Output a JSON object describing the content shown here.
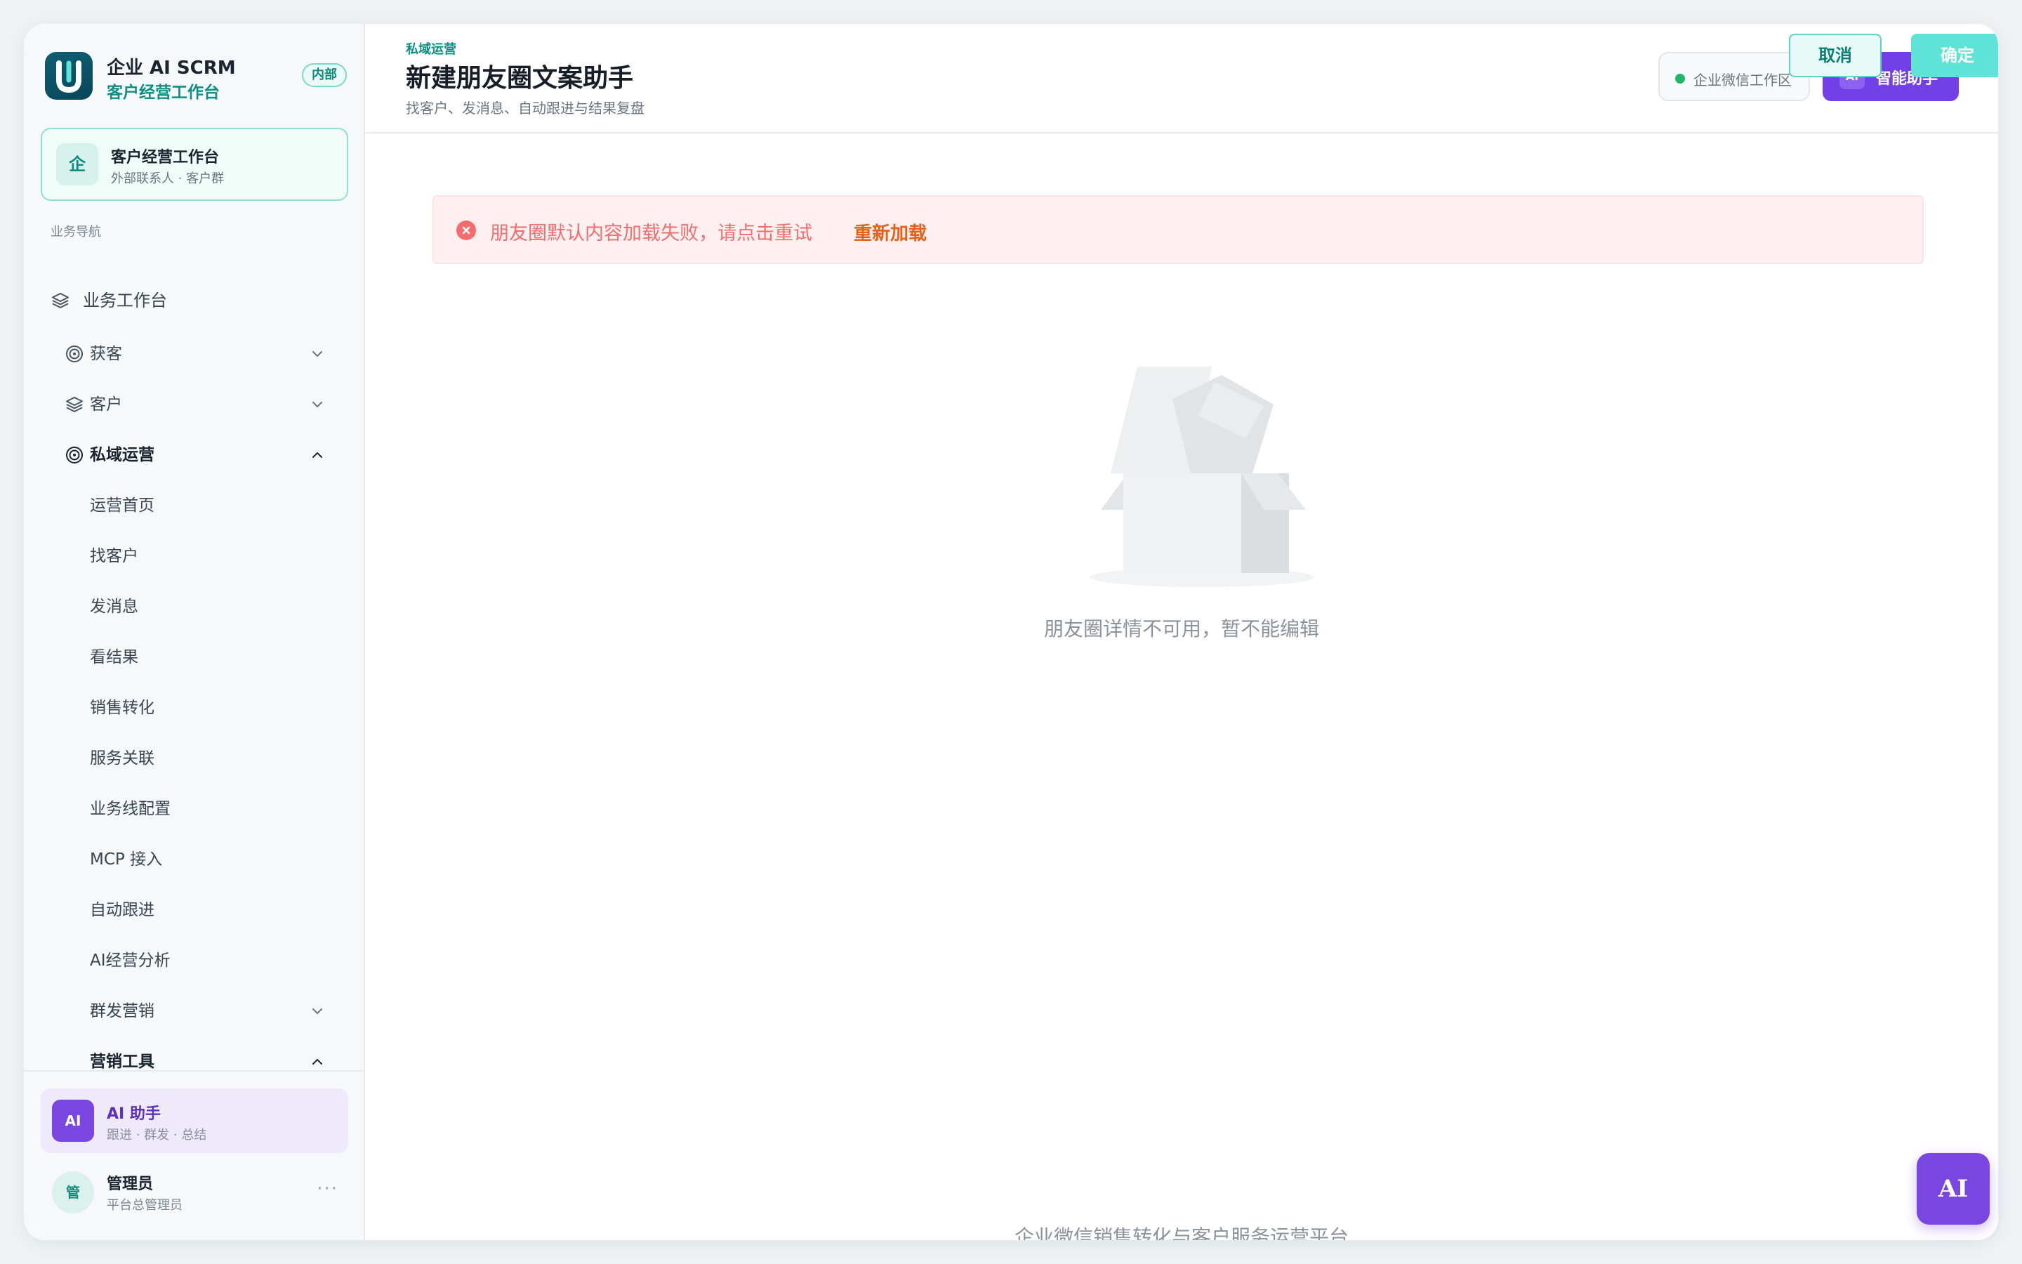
{
  "brand": {
    "title": "企业 AI SCRM",
    "subtitle": "客户经营工作台",
    "tag": "内部",
    "logo_letter": "U"
  },
  "workspace": {
    "icon": "企",
    "title": "客户经营工作台",
    "subtitle": "外部联系人 · 客户群"
  },
  "nav": {
    "heading": "业务导航",
    "dashboard": "业务工作台",
    "acquire": "获客",
    "customer": "客户",
    "private_ops": "私域运营",
    "sub_items": [
      "运营首页",
      "找客户",
      "发消息",
      "看结果",
      "销售转化",
      "服务关联",
      "业务线配置",
      "MCP 接入",
      "自动跟进",
      "AI经营分析"
    ],
    "group_marketing": "群发营销",
    "marketing_tools": "营销工具"
  },
  "ai_card": {
    "badge": "AI",
    "title": "AI 助手",
    "subtitle": "跟进 · 群发 · 总结"
  },
  "user": {
    "avatar": "管",
    "name": "管理员",
    "role": "平台总管理员",
    "more": "···"
  },
  "header": {
    "breadcrumb": "私域运营",
    "title": "新建朋友圈文案助手",
    "subtitle": "找客户、发消息、自动跟进与结果复盘",
    "env_label": "企业微信工作区",
    "assistant_badge": "AI",
    "assistant_label": "智能助手"
  },
  "dialog_buttons": {
    "cancel": "取消",
    "confirm": "确定"
  },
  "error": {
    "message": "朋友圈默认内容加载失败，请点击重试",
    "retry": "重新加载"
  },
  "empty_state": {
    "message": "朋友圈详情不可用，暂不能编辑"
  },
  "footer": {
    "text": "企业微信销售转化与客户服务运营平台"
  },
  "fab": {
    "label": "AI"
  },
  "colors": {
    "accent_teal": "#0f8f84",
    "ai_purple": "#7a45e0",
    "error_red": "#f56c6c",
    "retry_orange": "#e3611a"
  }
}
